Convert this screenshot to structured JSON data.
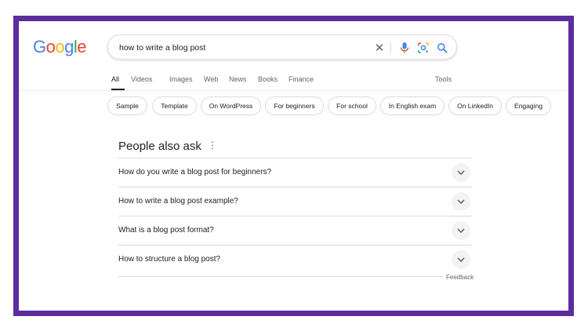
{
  "logo": {
    "text": "Google",
    "letters": [
      {
        "ch": "G",
        "color": "#4285F4"
      },
      {
        "ch": "o",
        "color": "#EA4335"
      },
      {
        "ch": "o",
        "color": "#FBBC05"
      },
      {
        "ch": "g",
        "color": "#4285F4"
      },
      {
        "ch": "l",
        "color": "#34A853"
      },
      {
        "ch": "e",
        "color": "#EA4335"
      }
    ]
  },
  "search": {
    "query": "how to write a blog post",
    "icons": [
      "close-icon",
      "mic-icon",
      "lens-icon",
      "search-icon"
    ]
  },
  "tabs": {
    "items": [
      "All",
      "Videos",
      "Images",
      "Web",
      "News",
      "Books",
      "Finance"
    ],
    "active": "All",
    "tools_label": "Tools"
  },
  "chips": [
    "Sample",
    "Template",
    "On WordPress",
    "For beginners",
    "For school",
    "In English exam",
    "On LinkedIn",
    "Engaging"
  ],
  "people_also_ask": {
    "title": "People also ask",
    "menu_icon": "more-vert-icon",
    "questions": [
      "How do you write a blog post for beginners?",
      "How to write a blog post example?",
      "What is a blog post format?",
      "How to structure a blog post?"
    ],
    "expand_icon": "chevron-down-icon"
  },
  "feedback_label": "Feedback",
  "colors": {
    "frame_border": "#5b2d9e",
    "accent_blue": "#4285F4",
    "text_primary": "#202124",
    "text_secondary": "#5f6368"
  }
}
